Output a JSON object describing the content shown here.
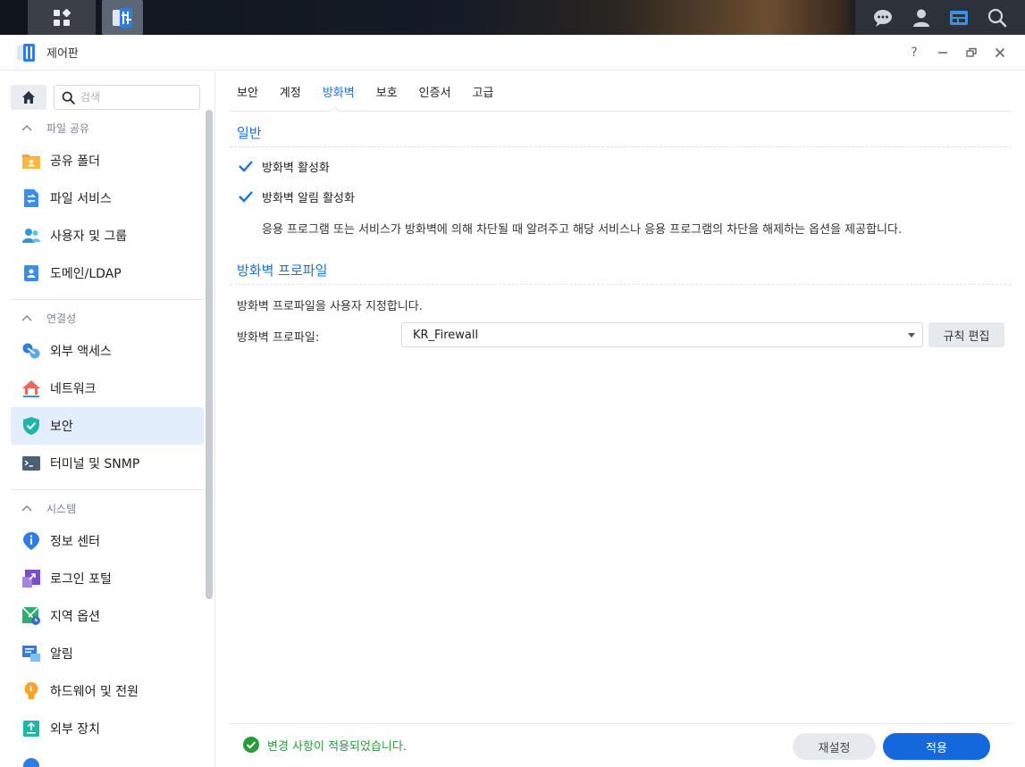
{
  "window": {
    "title": "제어판"
  },
  "colors": {
    "accent": "#1a73d9",
    "apply": "#1468db",
    "success": "#2a9a3a",
    "active_bg": "#e2eefb"
  },
  "sidebar": {
    "search_placeholder": "검색",
    "sections": [
      {
        "label": "파일 공유",
        "items": [
          {
            "label": "공유 폴더",
            "icon": "shared-folder-icon"
          },
          {
            "label": "파일 서비스",
            "icon": "file-services-icon"
          },
          {
            "label": "사용자 및 그룹",
            "icon": "users-groups-icon"
          },
          {
            "label": "도메인/LDAP",
            "icon": "domain-ldap-icon"
          }
        ]
      },
      {
        "label": "연결성",
        "items": [
          {
            "label": "외부 액세스",
            "icon": "external-access-icon"
          },
          {
            "label": "네트워크",
            "icon": "network-icon"
          },
          {
            "label": "보안",
            "icon": "security-shield-icon",
            "active": true
          },
          {
            "label": "터미널 및 SNMP",
            "icon": "terminal-icon"
          }
        ]
      },
      {
        "label": "시스템",
        "items": [
          {
            "label": "정보 센터",
            "icon": "info-center-icon"
          },
          {
            "label": "로그인 포털",
            "icon": "login-portal-icon"
          },
          {
            "label": "지역 옵션",
            "icon": "regional-options-icon"
          },
          {
            "label": "알림",
            "icon": "notification-icon"
          },
          {
            "label": "하드웨어 및 전원",
            "icon": "hardware-power-icon"
          },
          {
            "label": "외부 장치",
            "icon": "external-devices-icon"
          }
        ]
      }
    ]
  },
  "tabs": [
    "보안",
    "계정",
    "방화벽",
    "보호",
    "인증서",
    "고급"
  ],
  "active_tab": "방화벽",
  "general": {
    "title": "일반",
    "enable_firewall": {
      "label": "방화벽 활성화",
      "checked": true
    },
    "enable_notifications": {
      "label": "방화벽 알림 활성화",
      "checked": true
    },
    "description": "응용 프로그램 또는 서비스가 방화벽에 의해 차단될 때 알려주고 해당 서비스나 응용 프로그램의 차단을 해제하는 옵션을 제공합니다."
  },
  "profile": {
    "title": "방화벽 프로파일",
    "description": "방화벽 프로파일을 사용자 지정합니다.",
    "field_label": "방화벽 프로파일:",
    "selected": "KR_Firewall",
    "edit_rules_label": "규칙 편집"
  },
  "footer": {
    "status": "변경 사항이 적용되었습니다.",
    "reset_label": "재설정",
    "apply_label": "적용"
  }
}
